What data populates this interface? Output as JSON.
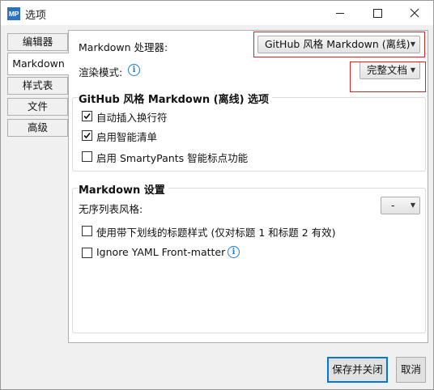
{
  "window": {
    "title": "选项",
    "app_icon_text": "MP"
  },
  "tabs": [
    {
      "label": "编辑器"
    },
    {
      "label": "Markdown"
    },
    {
      "label": "样式表"
    },
    {
      "label": "文件"
    },
    {
      "label": "高级"
    }
  ],
  "markdown": {
    "processor_label": "Markdown 处理器:",
    "processor_value": "GitHub 风格 Markdown (离线)",
    "render_mode_label": "渲染模式:",
    "render_mode_value": "完整文档",
    "github_group": {
      "title": "GitHub 风格 Markdown (离线) 选项",
      "options": [
        {
          "label": "自动插入换行符",
          "checked": true
        },
        {
          "label": "启用智能清单",
          "checked": true
        },
        {
          "label": "启用 SmartyPants 智能标点功能",
          "checked": false
        }
      ]
    },
    "md_group": {
      "title": "Markdown 设置",
      "list_style_label": "无序列表风格:",
      "list_style_value": "-",
      "options": [
        {
          "label": "使用带下划线的标题样式 (仅对标题 1 和标题 2 有效)",
          "checked": false
        },
        {
          "label": "Ignore YAML Front-matter",
          "checked": false
        }
      ]
    }
  },
  "buttons": {
    "save_close": "保存并关闭",
    "cancel": "取消"
  },
  "colors": {
    "highlight_box": "#d62424",
    "info_icon": "#1a7fd1",
    "app_icon": "#2a72c6"
  }
}
